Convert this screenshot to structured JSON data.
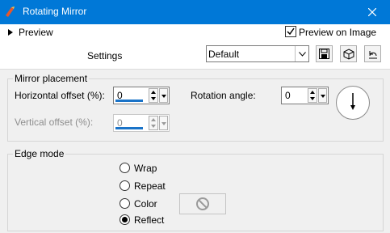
{
  "window": {
    "title": "Rotating Mirror",
    "close_icon": "close-icon",
    "app_icon": "app-icon"
  },
  "preview": {
    "label": "Preview",
    "preview_on_image_label": "Preview on Image",
    "preview_on_image_checked": true
  },
  "settings": {
    "label": "Settings",
    "preset_value": "Default",
    "buttons": [
      "save-preset-icon",
      "resource-icon",
      "reset-icon"
    ]
  },
  "mirror_placement": {
    "title": "Mirror placement",
    "horizontal_offset_label": "Horizontal offset (%):",
    "horizontal_offset_value": "0",
    "vertical_offset_label": "Vertical offset (%):",
    "vertical_offset_value": "0",
    "rotation_angle_label": "Rotation angle:",
    "rotation_angle_value": "0"
  },
  "edge_mode": {
    "title": "Edge mode",
    "options": [
      {
        "label": "Wrap",
        "selected": false
      },
      {
        "label": "Repeat",
        "selected": false
      },
      {
        "label": "Color",
        "selected": false
      },
      {
        "label": "Reflect",
        "selected": true
      }
    ]
  },
  "colors": {
    "titlebar": "#0078d7",
    "accent_bar": "#1a73c8"
  }
}
